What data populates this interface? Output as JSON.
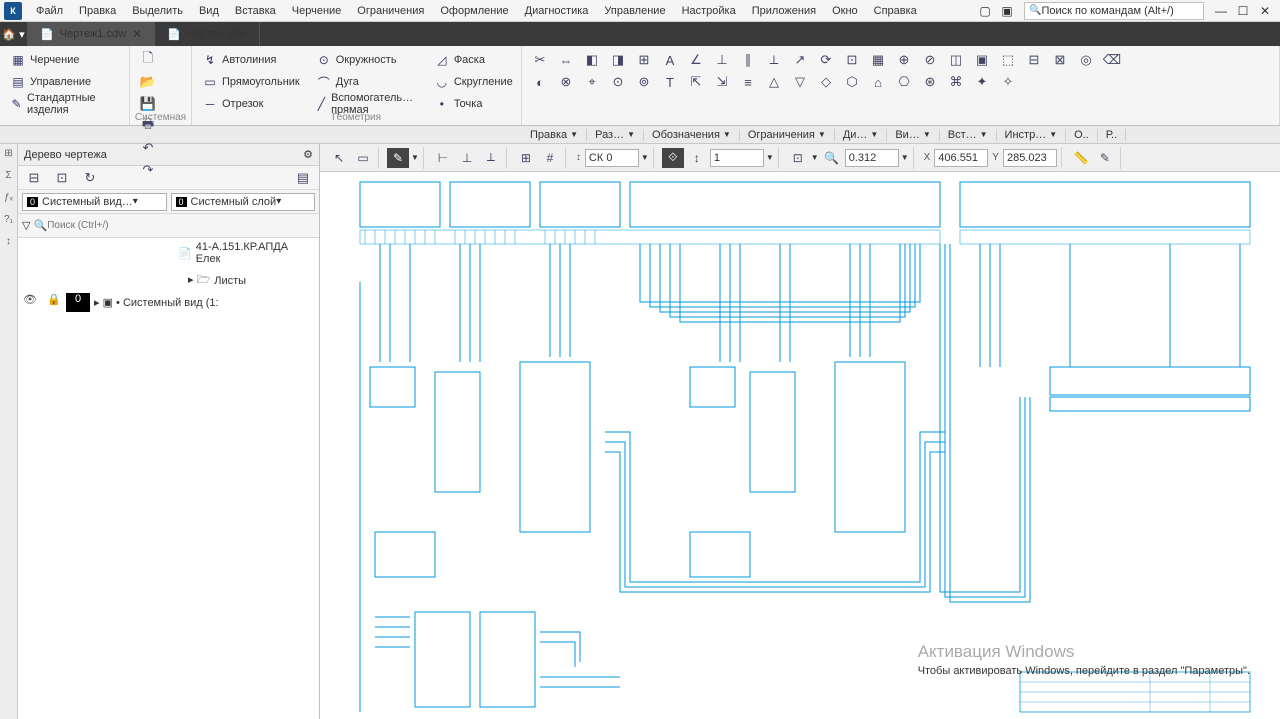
{
  "app_icon": "К",
  "menu": [
    "Файл",
    "Правка",
    "Выделить",
    "Вид",
    "Вставка",
    "Черчение",
    "Ограничения",
    "Оформление",
    "Диагностика",
    "Управление",
    "Настройка",
    "Приложения",
    "Окно",
    "Справка"
  ],
  "search_placeholder": "Поиск по командам (Alt+/)",
  "tabs": [
    {
      "label": "Чертеж1.cdw",
      "active": true
    },
    {
      "label": "Чертеж.cdw",
      "active": false
    }
  ],
  "ribbon": {
    "left_cmds": [
      "Черчение",
      "Управление",
      "Стандартные изделия"
    ],
    "sys_label": "Системная",
    "geom": {
      "label": "Геометрия",
      "col1": [
        "Автолиния",
        "Прямоугольник",
        "Отрезок"
      ],
      "col2": [
        "Окружность",
        "Дуга",
        "Вспомогатель… прямая"
      ],
      "col3": [
        "Фаска",
        "Скругление",
        "Точка"
      ]
    },
    "cats": [
      "Правка",
      "Раз…",
      "Обозначения",
      "Ограничения",
      "Ди…",
      "Ви…",
      "Вст…",
      "Инстр…",
      "О..",
      "Р.."
    ]
  },
  "side": {
    "title": "Дерево чертежа",
    "view_select": "Системный вид…",
    "layer_select": "Системный слой",
    "search_placeholder": "Поиск (Ctrl+/)",
    "doc": "41-А.151.КР.АПДА Елек",
    "sheets": "Листы",
    "sysview": "Системный вид (1:"
  },
  "propbar": {
    "ck": "СК 0",
    "step": "1",
    "zoom": "0.312",
    "x": "406.551",
    "y": "285.023"
  },
  "watermark": {
    "title": "Активация Windows",
    "sub": "Чтобы активировать Windows, перейдите в раздел \"Параметры\"."
  }
}
